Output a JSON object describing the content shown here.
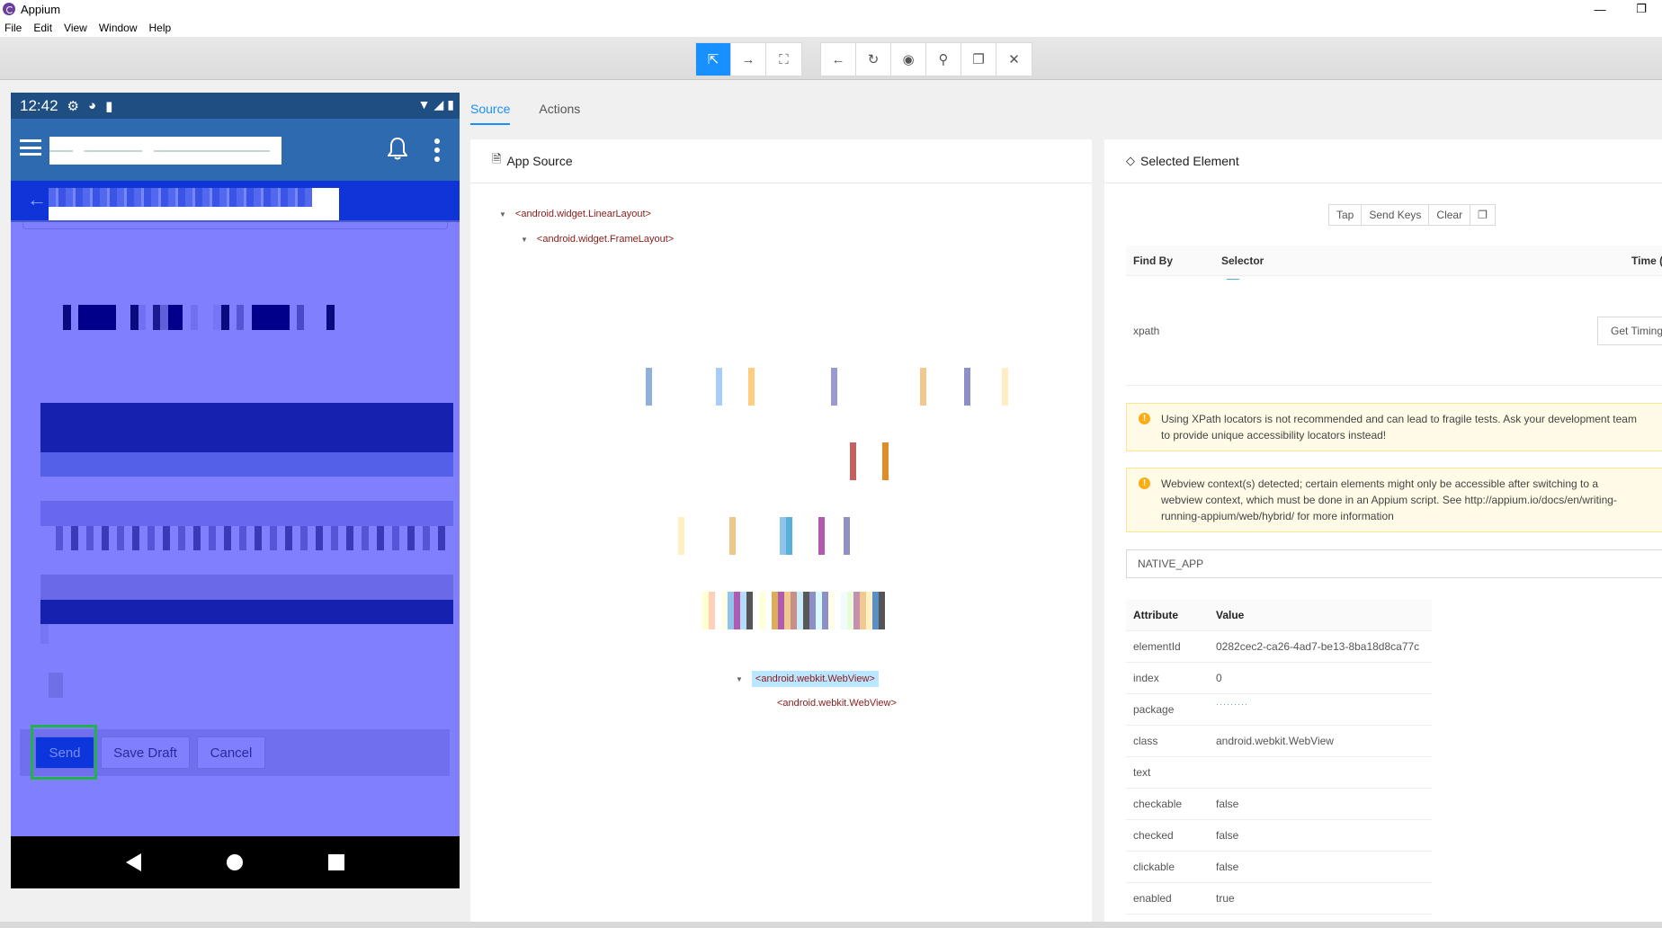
{
  "window": {
    "title": "Appium",
    "controls": {
      "minimize": "—",
      "maximize": "❐"
    }
  },
  "menu": [
    "File",
    "Edit",
    "View",
    "Window",
    "Help"
  ],
  "toolbar": {
    "group1": [
      {
        "name": "select-elements",
        "icon": "⇱",
        "active": true
      },
      {
        "name": "swipe-by-coordinates",
        "icon": "→",
        "active": false
      },
      {
        "name": "tap-by-coordinates",
        "icon": "⛶",
        "active": false
      }
    ],
    "group2": [
      {
        "name": "back",
        "icon": "←"
      },
      {
        "name": "refresh",
        "icon": "↻"
      },
      {
        "name": "toggle-attributes",
        "icon": "◉"
      },
      {
        "name": "search",
        "icon": "⚲"
      },
      {
        "name": "copy-xml",
        "icon": "❐"
      },
      {
        "name": "quit-session",
        "icon": "✕"
      }
    ]
  },
  "phone": {
    "time": "12:42",
    "status_icons_left": [
      "⚙",
      "◕",
      "▮"
    ],
    "status_icons_right": [
      "▼",
      "◢",
      "▮"
    ],
    "buttons": {
      "send": "Send",
      "save_draft": "Save Draft",
      "cancel": "Cancel"
    },
    "colors": {
      "overlay": "#8080ff",
      "app_bar": "#2d6aaf",
      "status_bar": "#1f4e82",
      "sub_bar": "#0f35d9",
      "highlight": "#22b14c"
    }
  },
  "tabs": [
    {
      "label": "Source",
      "active": true
    },
    {
      "label": "Actions",
      "active": false
    }
  ],
  "source": {
    "header": "App Source",
    "nodes": {
      "linear_layout": "<android.widget.LinearLayout>",
      "frame_layout": "<android.widget.FrameLayout>",
      "webview_selected": "<android.webkit.WebView>",
      "webview_child": "<android.webkit.WebView>"
    }
  },
  "selected": {
    "header": "Selected Element",
    "actions": [
      "Tap",
      "Send Keys",
      "Clear",
      "❐"
    ],
    "find_by_header": "Find By",
    "selector_header": "Selector",
    "time_header": "Time (ms)",
    "find_by_value": "xpath",
    "get_timing": "Get Timing",
    "alerts": [
      "Using XPath locators is not recommended and can lead to fragile tests. Ask your development team to provide unique accessibility locators instead!",
      "Webview context(s) detected; certain elements might only be accessible after switching to a webview context, which must be done in an Appium script. See http://appium.io/docs/en/writing-running-appium/web/hybrid/ for more information"
    ],
    "context": "NATIVE_APP",
    "attr_header": {
      "key": "Attribute",
      "value": "Value"
    },
    "attributes": [
      {
        "key": "elementId",
        "value": "0282cec2-ca26-4ad7-be13-8ba18d8ca77c"
      },
      {
        "key": "index",
        "value": "0"
      },
      {
        "key": "package",
        "value": "·········"
      },
      {
        "key": "class",
        "value": "android.webkit.WebView"
      },
      {
        "key": "text",
        "value": ""
      },
      {
        "key": "checkable",
        "value": "false"
      },
      {
        "key": "checked",
        "value": "false"
      },
      {
        "key": "clickable",
        "value": "false"
      },
      {
        "key": "enabled",
        "value": "true"
      }
    ]
  }
}
